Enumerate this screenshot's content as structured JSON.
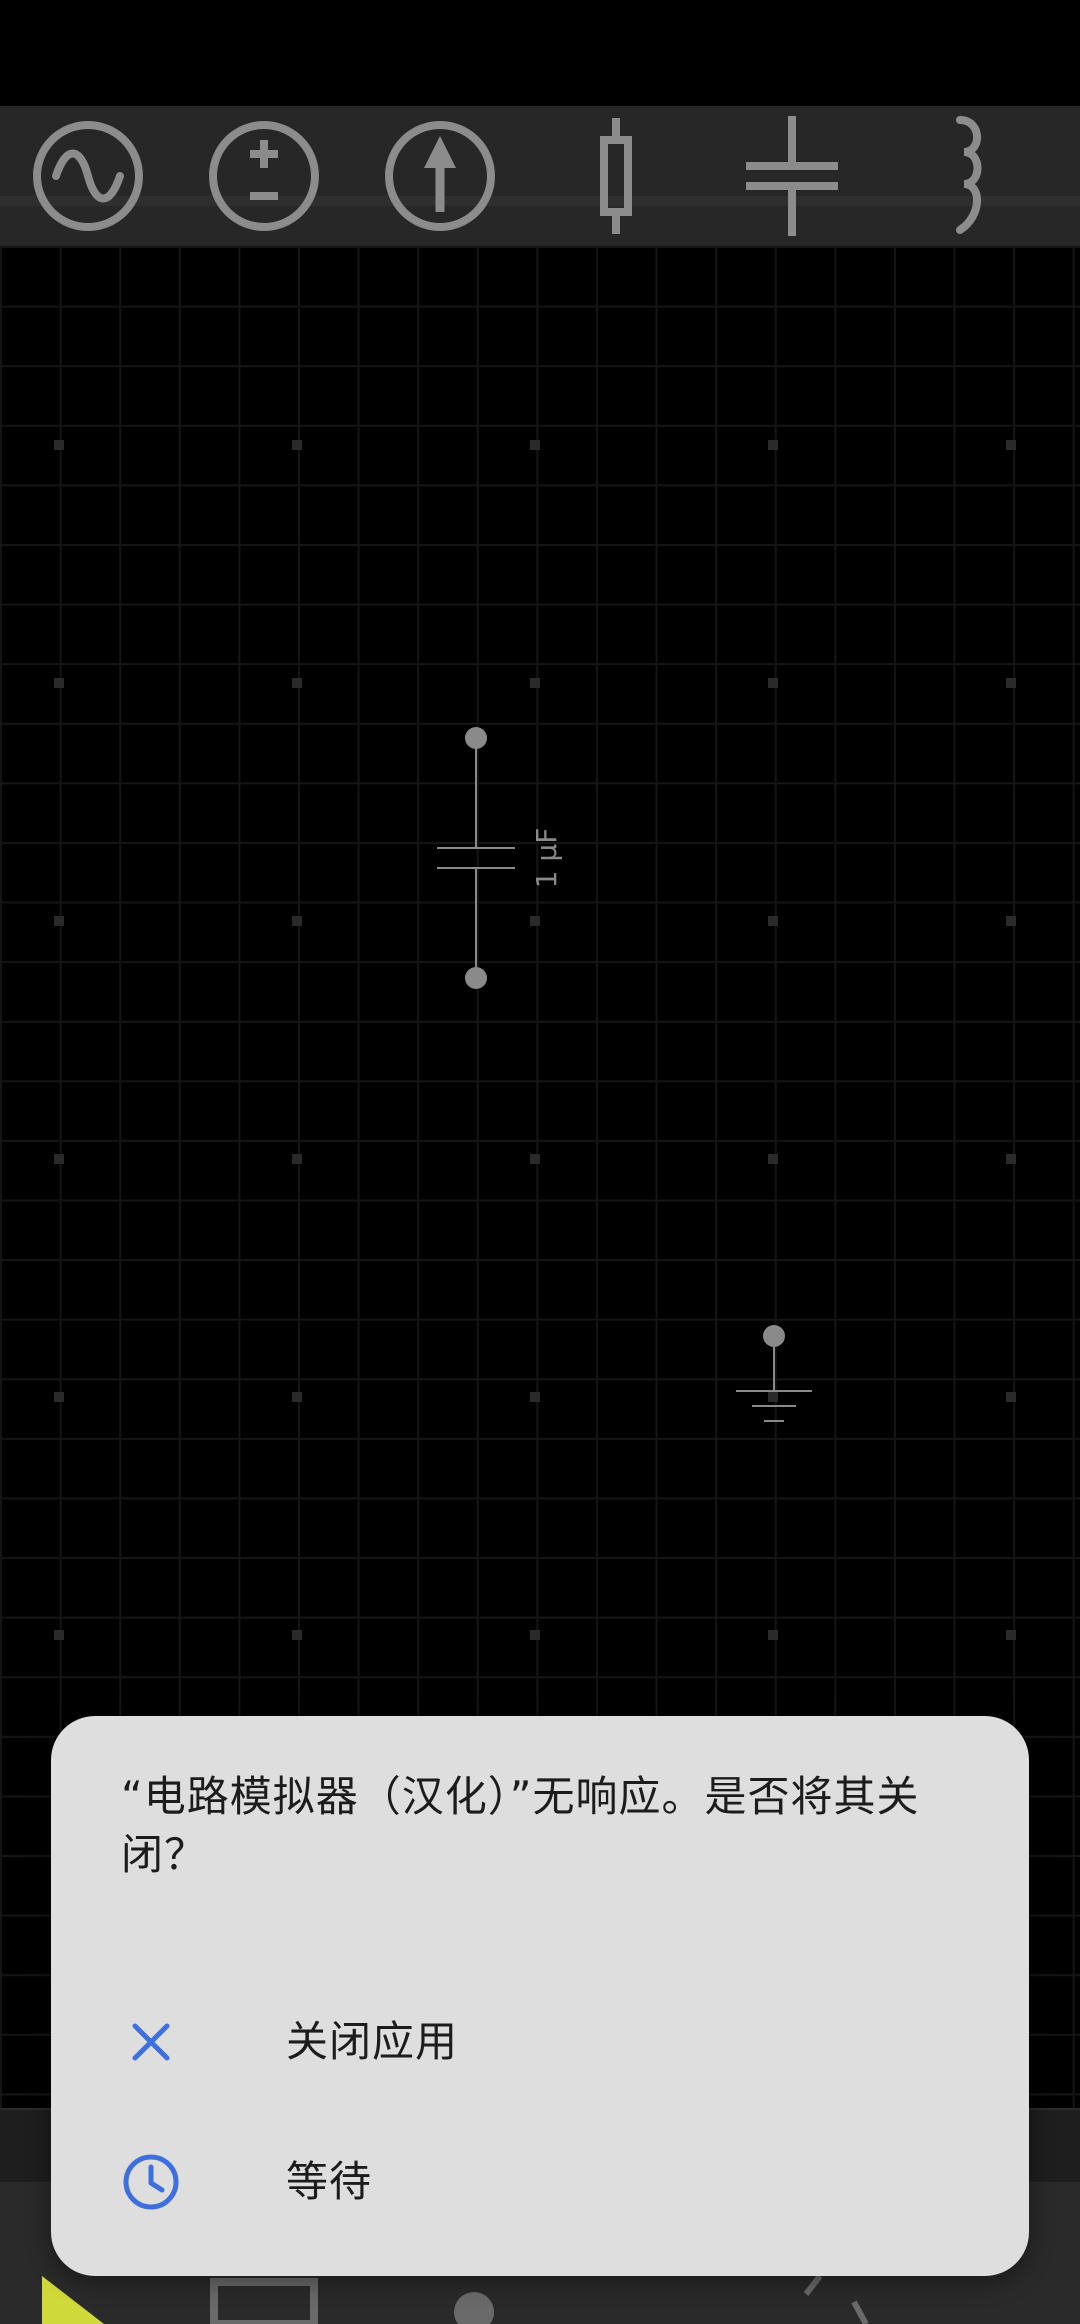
{
  "toolbar": {
    "tools": [
      {
        "icon": "ac-source-icon"
      },
      {
        "icon": "dc-voltage-source-icon"
      },
      {
        "icon": "current-source-icon"
      },
      {
        "icon": "resistor-icon"
      },
      {
        "icon": "capacitor-icon"
      },
      {
        "icon": "inductor-icon"
      }
    ]
  },
  "canvas": {
    "capacitor_label": "1 μF"
  },
  "dialog": {
    "message": "“电路模拟器（汉化）”无响应。是否将其关闭？",
    "close_label": "关闭应用",
    "wait_label": "等待"
  },
  "colors": {
    "accent": "#3d6fe0",
    "dialog_bg": "#dedede",
    "toolbar_bg": "#272727",
    "component": "#8a8a8a"
  }
}
